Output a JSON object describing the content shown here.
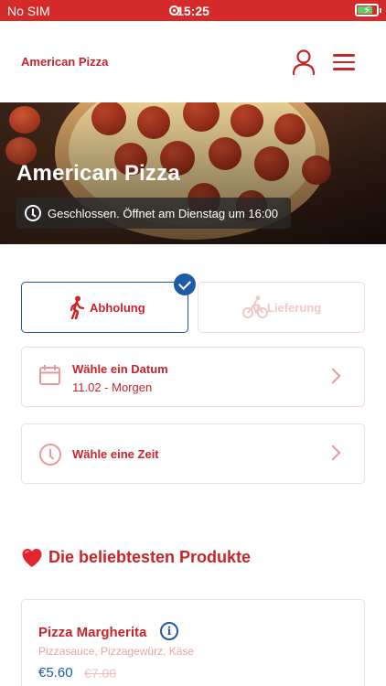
{
  "status_bar": {
    "carrier": "No SIM",
    "time": "15:25",
    "battery_level": 0.8
  },
  "header": {
    "brand": "American Pizza"
  },
  "hero": {
    "title": "American Pizza",
    "status_text": "Geschlossen. Öffnet am Dienstag um 16:00"
  },
  "order_type": {
    "pickup_label": "Abholung",
    "delivery_label": "Lieferung",
    "selected": "pickup"
  },
  "date_select": {
    "title": "Wähle ein Datum",
    "value": "11.02 - Morgen"
  },
  "time_select": {
    "title": "Wähle eine Zeit"
  },
  "popular": {
    "heading": "Die beliebtesten Produkte",
    "products": [
      {
        "name": "Pizza Margherita",
        "description": "Pizzasauce, Pizzagewürz, Käse",
        "price": "€5.60",
        "old_price": "€7.00"
      }
    ]
  },
  "colors": {
    "accent": "#c8242a",
    "primary_blue": "#1f5aa8",
    "status_bar": "#d42a2a"
  }
}
